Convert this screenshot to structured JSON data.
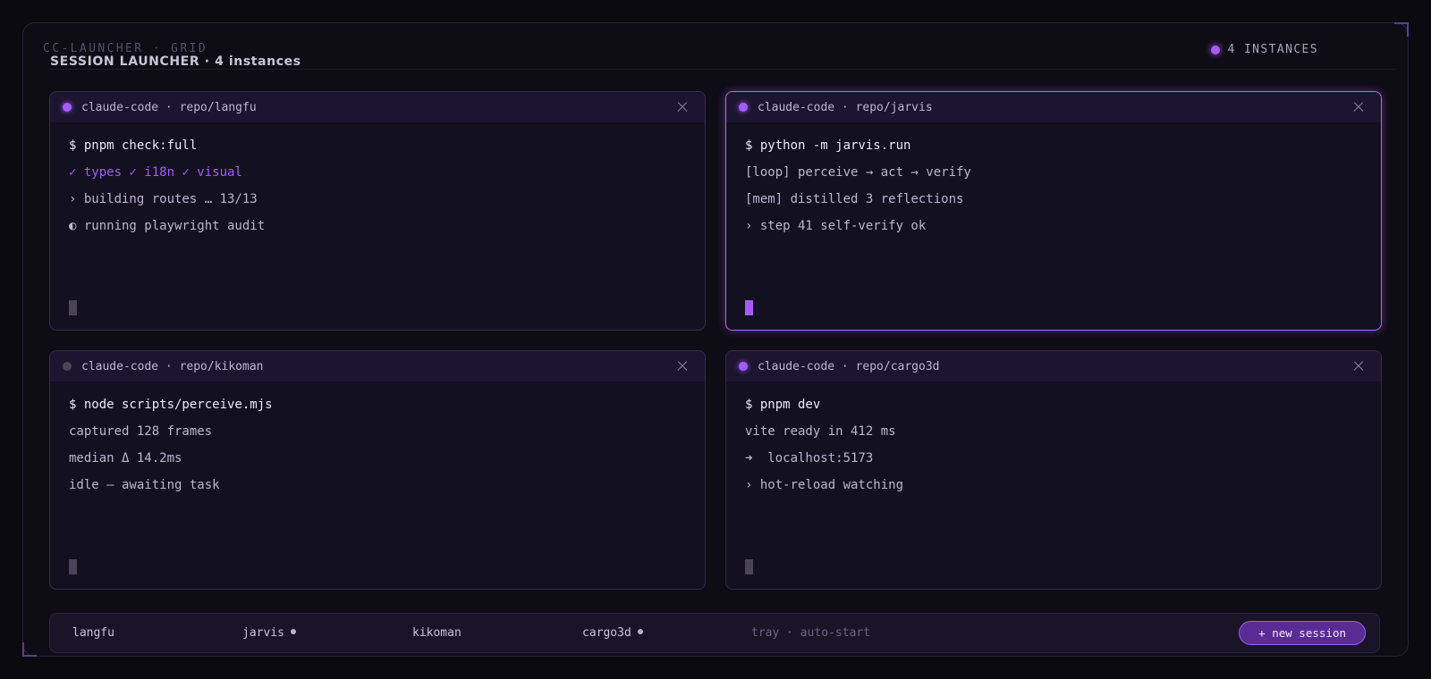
{
  "header": {
    "kicker": "CC-LAUNCHER · GRID",
    "title": "SESSION LAUNCHER · 4 instances",
    "instances_label": "4 INSTANCES"
  },
  "colors": {
    "accent": "#a55bf5",
    "idle": "#4a4658",
    "background": "#0b0a0f",
    "pane": "#131020"
  },
  "sessions": [
    {
      "title": "claude-code · repo/langfu",
      "status": "active",
      "lines": [
        {
          "text": "$ pnpm check:full",
          "kind": "cmd"
        },
        {
          "text": "✓ types ✓ i18n ✓ visual",
          "kind": "ok"
        },
        {
          "text": "› building routes … 13/13",
          "kind": "out"
        },
        {
          "text": "◐ running playwright audit",
          "kind": "out"
        }
      ]
    },
    {
      "title": "claude-code · repo/jarvis",
      "status": "focused",
      "lines": [
        {
          "text": "$ python -m jarvis.run",
          "kind": "cmd"
        },
        {
          "text": "[loop] perceive → act → verify",
          "kind": "out"
        },
        {
          "text": "[mem] distilled 3 reflections",
          "kind": "out"
        },
        {
          "text": "› step 41 self-verify ok",
          "kind": "out"
        }
      ]
    },
    {
      "title": "claude-code · repo/kikoman",
      "status": "idle",
      "lines": [
        {
          "text": "$ node scripts/perceive.mjs",
          "kind": "cmd"
        },
        {
          "text": "captured 128 frames",
          "kind": "out"
        },
        {
          "text": "median Δ 14.2ms",
          "kind": "out"
        },
        {
          "text": "idle — awaiting task",
          "kind": "out"
        }
      ]
    },
    {
      "title": "claude-code · repo/cargo3d",
      "status": "active",
      "lines": [
        {
          "text": "$ pnpm dev",
          "kind": "cmd"
        },
        {
          "text": "vite ready in 412 ms",
          "kind": "out"
        },
        {
          "text": "➜  localhost:5173",
          "kind": "out"
        },
        {
          "text": "› hot-reload watching",
          "kind": "out"
        }
      ]
    }
  ],
  "taskbar": {
    "items": [
      {
        "label": "langfu",
        "indicator": false
      },
      {
        "label": "jarvis",
        "indicator": true
      },
      {
        "label": "kikoman",
        "indicator": false
      },
      {
        "label": "cargo3d",
        "indicator": true
      }
    ],
    "note": "tray · auto-start",
    "new_session_label": "+ new session"
  }
}
